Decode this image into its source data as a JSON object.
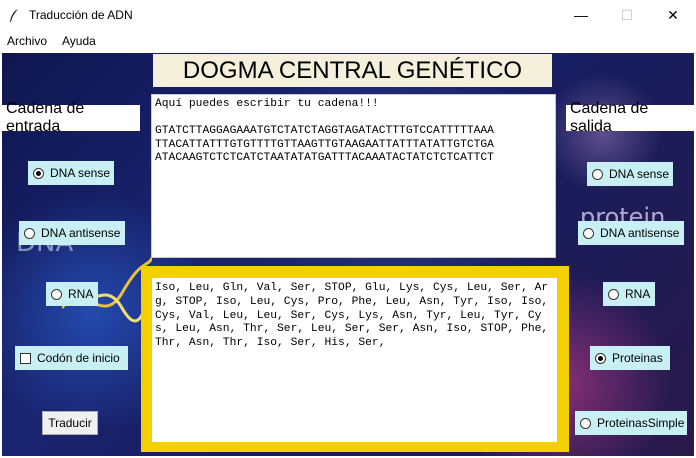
{
  "window": {
    "title": "Traducción de ADN",
    "app_icon": "feather-icon",
    "minimize_glyph": "—",
    "maximize_glyph": "☐",
    "close_glyph": "✕"
  },
  "menu": {
    "items": [
      "Archivo",
      "Ayuda"
    ]
  },
  "app": {
    "title": "DOGMA CENTRAL GENÉTICO",
    "background_words": {
      "left": "DNA",
      "right": "protein"
    },
    "input_label": "Cadena de entrada",
    "output_label": "Cadena de salida",
    "input_text": "Aquí puedes escribir tu cadena!!!\n\nGTATCTTAGGAGAAATGTCTATCTAGGTAGATACTTTGTCCATTTTTAAA\nTTACATTATTTGTGTTTTGTTAAGTTGTAAGAATTATTTATATTGTCTGA\nATACAAGTCTCTCATCTAATATATGATTTACAAATACTATCTCTCATTCT",
    "output_text": "Iso, Leu, Gln, Val, Ser, STOP, Glu, Lys, Cys, Leu, Ser, Arg, STOP, Iso, Leu, Cys, Pro, Phe, Leu, Asn, Tyr, Iso, Iso, Cys, Val, Leu, Leu, Ser, Cys, Lys, Asn, Tyr, Leu, Tyr, Cys, Leu, Asn, Thr, Ser, Leu, Ser, Ser, Asn, Iso, STOP, Phe, Thr, Asn, Thr, Iso, Ser, His, Ser,",
    "input_options": [
      {
        "label": "DNA sense",
        "selected": true
      },
      {
        "label": "DNA antisense",
        "selected": false
      },
      {
        "label": "RNA",
        "selected": false
      }
    ],
    "start_codon_label": "Codón de inicio",
    "start_codon_checked": false,
    "translate_button": "Traducir",
    "output_options": [
      {
        "label": "DNA sense",
        "selected": false
      },
      {
        "label": "DNA antisense",
        "selected": false
      },
      {
        "label": "RNA",
        "selected": false
      },
      {
        "label": "Proteinas",
        "selected": true
      },
      {
        "label": "ProteinasSimple",
        "selected": false
      }
    ],
    "colors": {
      "option_bg": "#c8f0f4",
      "output_frame": "#f5d000",
      "title_bg": "#f4f0dc"
    }
  }
}
